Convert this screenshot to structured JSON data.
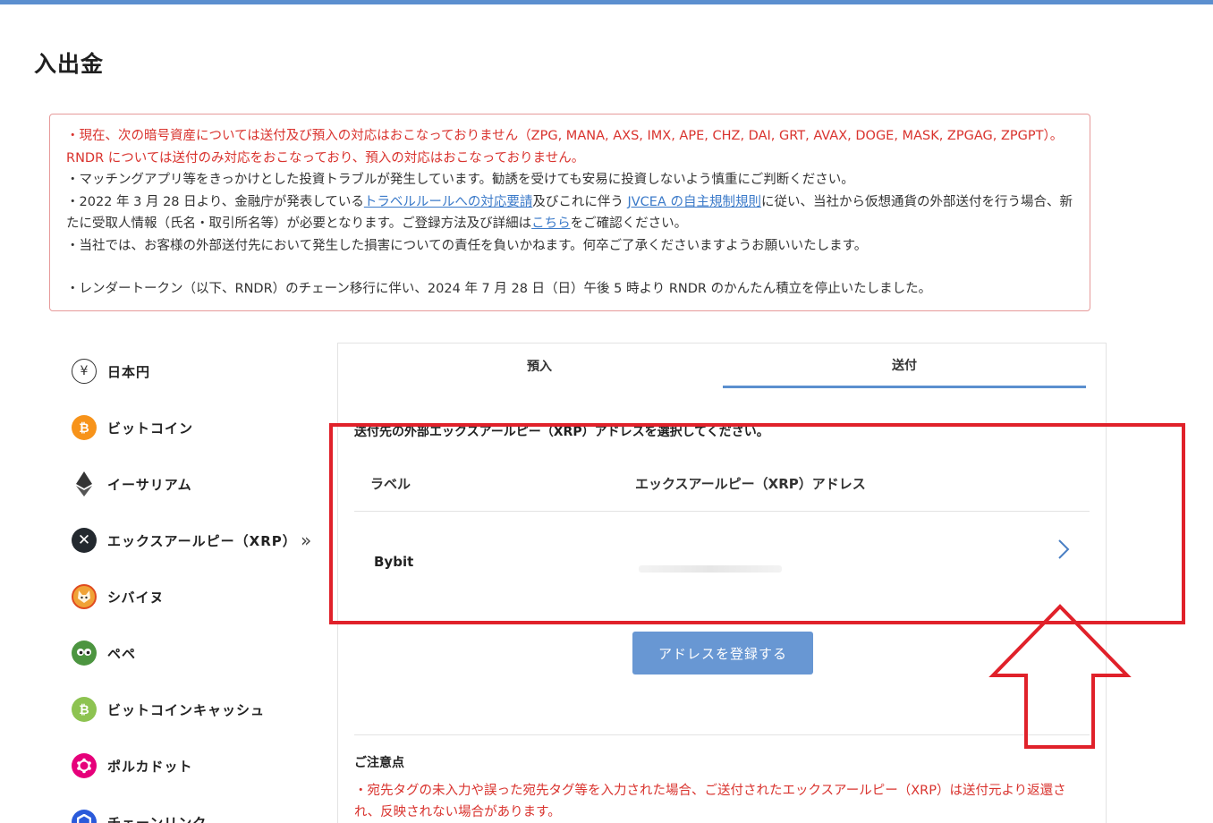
{
  "page": {
    "title": "入出金"
  },
  "notice": {
    "line1": "・現在、次の暗号資産については送付及び預入の対応はおこなっておりません（ZPG, MANA, AXS, IMX, APE, CHZ, DAI, GRT, AVAX, DOGE, MASK, ZPGAG, ZPGPT）。RNDR については送付のみ対応をおこなっており、預入の対応はおこなっておりません。",
    "line2": "・マッチングアプリ等をきっかけとした投資トラブルが発生しています。勧誘を受けても安易に投資しないよう慎重にご判断ください。",
    "line3_pre": "・2022 年 3 月 28 日より、金融庁が発表している",
    "line3_link1": "トラベルルールへの対応要請",
    "line3_mid": "及びこれに伴う ",
    "line3_link2": "JVCEA の自主規制規則",
    "line3_post": "に従い、当社から仮想通貨の外部送付を行う場合、新たに受取人情報（氏名・取引所名等）が必要となります。ご登録方法及び詳細は",
    "line3_link3": "こちら",
    "line3_end": "をご確認ください。",
    "line4": "・当社では、お客様の外部送付先において発生した損害についての責任を負いかねます。何卒ご了承くださいますようお願いいたします。",
    "line5": "・レンダートークン（以下、RNDR）のチェーン移行に伴い、2024 年 7 月 28 日（日）午後 5 時より RNDR のかんたん積立を停止いたしました。"
  },
  "sidebar": {
    "items": [
      {
        "label": "日本円",
        "icon": "yen-icon",
        "color": "#ffffff"
      },
      {
        "label": "ビットコイン",
        "icon": "bitcoin-icon",
        "color": "#f7931a"
      },
      {
        "label": "イーサリアム",
        "icon": "ethereum-icon",
        "color": "#ffffff"
      },
      {
        "label": "エックスアールピー（XRP）",
        "icon": "xrp-icon",
        "color": "#23292f"
      },
      {
        "label": "シバイヌ",
        "icon": "shiba-icon",
        "color": "#f0a236"
      },
      {
        "label": "ペペ",
        "icon": "pepe-icon",
        "color": "#4c9540"
      },
      {
        "label": "ビットコインキャッシュ",
        "icon": "bitcoin-cash-icon",
        "color": "#8dc351"
      },
      {
        "label": "ポルカドット",
        "icon": "polkadot-icon",
        "color": "#e6007a"
      },
      {
        "label": "チェーンリンク",
        "icon": "chainlink-icon",
        "color": "#2a5ada"
      }
    ],
    "active_arrow": "»"
  },
  "tabs": {
    "deposit": "預入",
    "send": "送付"
  },
  "send": {
    "instruction": "送付先の外部エックスアールピー（XRP）アドレスを選択してください。",
    "col_label": "ラベル",
    "col_address": "エックスアールピー（XRP）アドレス",
    "row": {
      "label": "Bybit"
    },
    "register_button": "アドレスを登録する"
  },
  "caution": {
    "title": "ご注意点",
    "text": "・宛先タグの未入力や誤った宛先タグ等を入力された場合、ご送付されたエックスアールピー（XRP）は送付元より返還され、反映されない場合があります。"
  },
  "colors": {
    "accent": "#5b8fcf",
    "button": "#6897d3",
    "alert_red": "#d9332e",
    "annotation_red": "#e0212a"
  }
}
